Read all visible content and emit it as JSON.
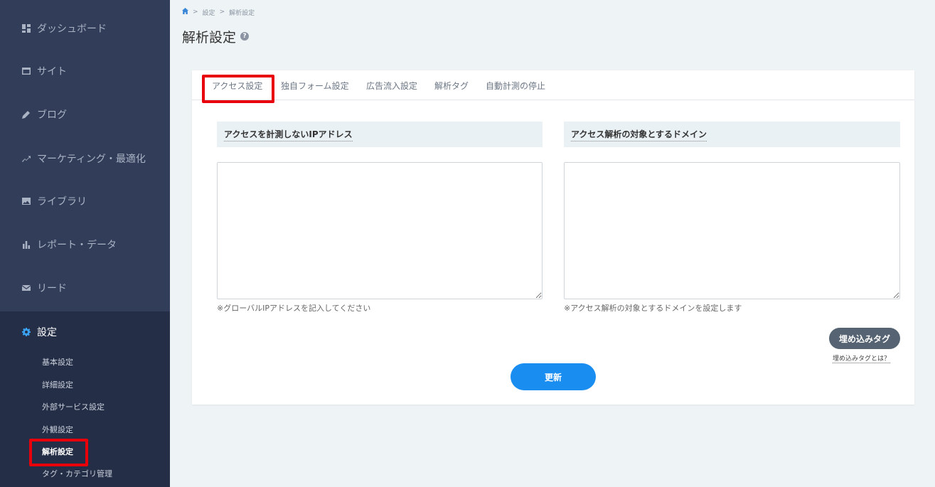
{
  "sidebar": {
    "items": [
      {
        "label": "ダッシュボード",
        "icon": "dashboard-icon"
      },
      {
        "label": "サイト",
        "icon": "site-icon"
      },
      {
        "label": "ブログ",
        "icon": "pencil-icon"
      },
      {
        "label": "マーケティング・最適化",
        "icon": "trend-icon"
      },
      {
        "label": "ライブラリ",
        "icon": "image-icon"
      },
      {
        "label": "レポート・データ",
        "icon": "bar-chart-icon"
      },
      {
        "label": "リード",
        "icon": "mail-icon"
      },
      {
        "label": "設定",
        "icon": "gear-icon"
      }
    ],
    "sub_items": [
      {
        "label": "基本設定"
      },
      {
        "label": "詳細設定"
      },
      {
        "label": "外部サービス設定"
      },
      {
        "label": "外観設定"
      },
      {
        "label": "解析設定"
      },
      {
        "label": "タグ・カテゴリ管理"
      }
    ],
    "active_item": "設定",
    "current_sub_item": "解析設定"
  },
  "breadcrumb": {
    "home_icon": "home-icon",
    "items": [
      "設定",
      "解析設定"
    ]
  },
  "page": {
    "title": "解析設定",
    "help_glyph": "?"
  },
  "tabs": [
    {
      "label": "アクセス設定",
      "active": true
    },
    {
      "label": "独自フォーム設定"
    },
    {
      "label": "広告流入設定"
    },
    {
      "label": "解析タグ"
    },
    {
      "label": "自動計測の停止"
    }
  ],
  "ip_section": {
    "heading": "アクセスを計測しないIPアドレス",
    "value": "",
    "hint": "※グローバルIPアドレスを記入してください"
  },
  "domain_section": {
    "heading": "アクセス解析の対象とするドメイン",
    "value": "",
    "hint": "※アクセス解析の対象とするドメインを設定します"
  },
  "buttons": {
    "embed_tag": "埋め込みタグ",
    "embed_tag_help": "埋め込みタグとは？",
    "update": "更新"
  },
  "colors": {
    "sidebar_bg": "#313d59",
    "sidebar_active_bg": "#242e46",
    "accent_blue": "#1a8df0",
    "highlight_red": "#e8000b"
  }
}
